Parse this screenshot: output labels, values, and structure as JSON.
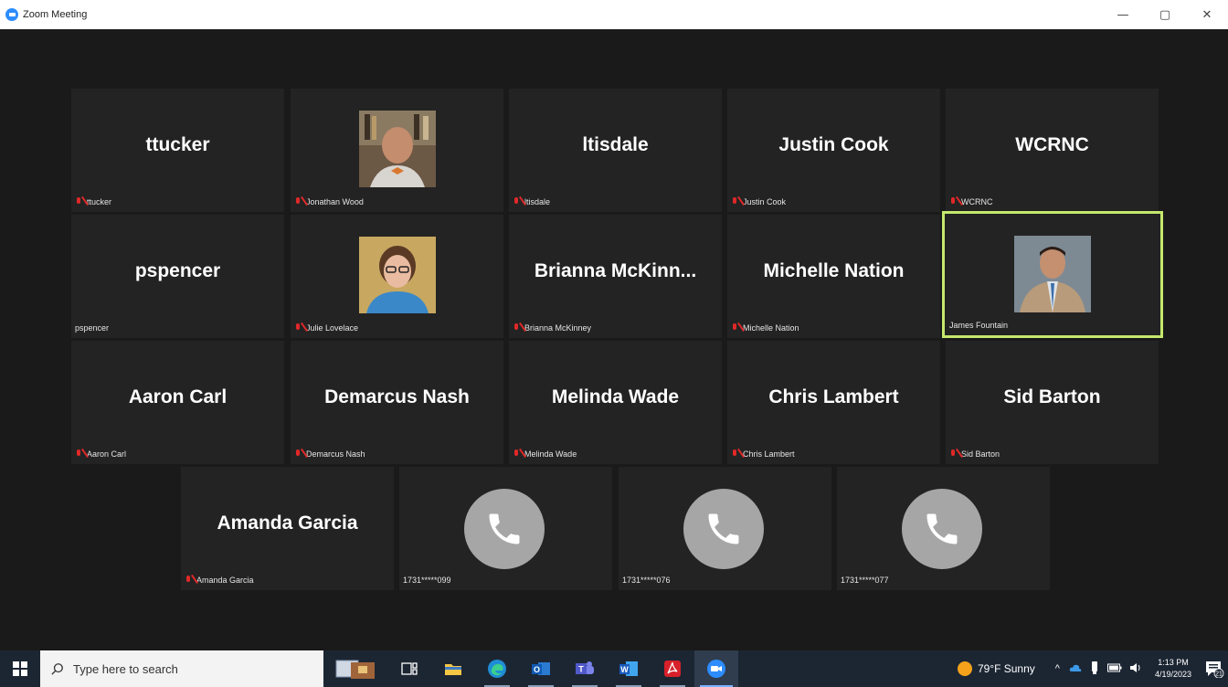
{
  "window": {
    "title": "Zoom Meeting",
    "minimize": "—",
    "restore": "▢",
    "close": "✕"
  },
  "tiles": [
    {
      "big_name": "ttucker",
      "label": "ttucker",
      "muted": true
    },
    {
      "big_name": "",
      "label": "Jonathan Wood",
      "muted": true,
      "video": true
    },
    {
      "big_name": "ltisdale",
      "label": "ltisdale",
      "muted": true
    },
    {
      "big_name": "Justin Cook",
      "label": "Justin Cook",
      "muted": true
    },
    {
      "big_name": "WCRNC",
      "label": "WCRNC",
      "muted": true
    },
    {
      "big_name": "pspencer",
      "label": "pspencer",
      "muted": false
    },
    {
      "big_name": "",
      "label": "Julie Lovelace",
      "muted": true,
      "video": true
    },
    {
      "big_name": "Brianna  McKinn...",
      "label": "Brianna McKinney",
      "muted": true
    },
    {
      "big_name": "Michelle Nation",
      "label": "Michelle Nation",
      "muted": true
    },
    {
      "big_name": "",
      "label": "James Fountain",
      "muted": false,
      "video": true,
      "active_speaker": true
    },
    {
      "big_name": "Aaron Carl",
      "label": "Aaron Carl",
      "muted": true
    },
    {
      "big_name": "Demarcus Nash",
      "label": "Demarcus Nash",
      "muted": true
    },
    {
      "big_name": "Melinda Wade",
      "label": "Melinda Wade",
      "muted": true
    },
    {
      "big_name": "Chris Lambert",
      "label": "Chris Lambert",
      "muted": true
    },
    {
      "big_name": "Sid Barton",
      "label": "Sid Barton",
      "muted": true
    },
    {
      "big_name": "Amanda Garcia",
      "label": "Amanda Garcia",
      "muted": true
    },
    {
      "big_name": "",
      "label": "1731*****099",
      "muted": false,
      "phone": true
    },
    {
      "big_name": "",
      "label": "1731*****076",
      "muted": false,
      "phone": true
    },
    {
      "big_name": "",
      "label": "1731*****077",
      "muted": false,
      "phone": true
    }
  ],
  "taskbar": {
    "search_placeholder": "Type here to search",
    "weather": "79°F  Sunny",
    "time": "1:13 PM",
    "date": "4/19/2023",
    "notification_count": "21"
  },
  "colors": {
    "active_speaker_border": "#c5e86c",
    "muted_icon": "#e02828",
    "tile_bg": "#232323",
    "phone_circle": "#a6a6a6"
  }
}
